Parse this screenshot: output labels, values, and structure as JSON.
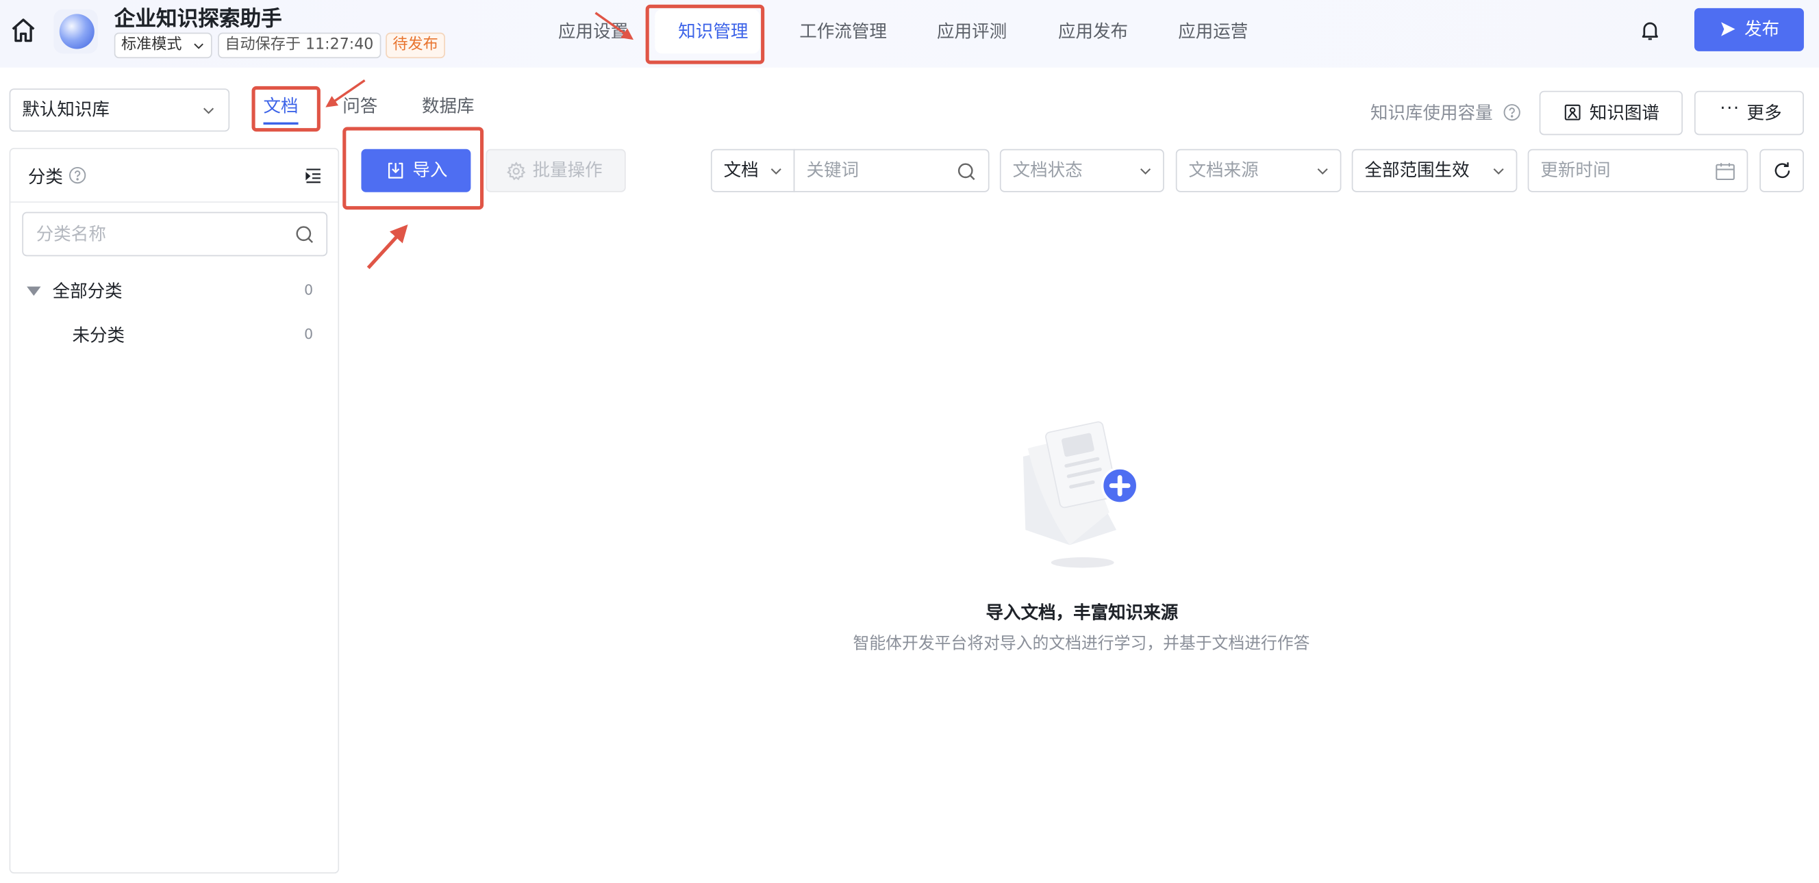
{
  "header": {
    "app_title": "企业知识探索助手",
    "mode": "标准模式",
    "autosave": "自动保存于 11:27:40",
    "status_badge": "待发布",
    "nav_tabs": [
      "应用设置",
      "知识管理",
      "工作流管理",
      "应用评测",
      "应用发布",
      "应用运营"
    ],
    "active_tab": "知识管理",
    "publish_label": "发布",
    "accent_color": "#4e6ef2",
    "icons": [
      "home-icon",
      "bell-icon",
      "send-icon"
    ]
  },
  "subbar": {
    "kb_select": "默认知识库",
    "tabs": [
      "文档",
      "问答",
      "数据库"
    ],
    "active_tab": "文档",
    "usage_label": "知识库使用容量",
    "graph_button": "知识图谱",
    "more_button": "更多"
  },
  "sidebar": {
    "title": "分类",
    "search_placeholder": "分类名称",
    "tree": [
      {
        "label": "全部分类",
        "count": "0"
      },
      {
        "label": "未分类",
        "count": "0"
      }
    ]
  },
  "toolbar": {
    "import_label": "导入",
    "batch_label": "批量操作",
    "type_filter": "文档",
    "keyword_placeholder": "关键词",
    "status_filter_placeholder": "文档状态",
    "source_filter_placeholder": "文档来源",
    "scope_filter": "全部范围生效",
    "update_time_placeholder": "更新时间"
  },
  "empty_state": {
    "title": "导入文档，丰富知识来源",
    "subtitle": "智能体开发平台将对导入的文档进行学习，并基于文档进行作答"
  },
  "annotation_color": "#e05546"
}
